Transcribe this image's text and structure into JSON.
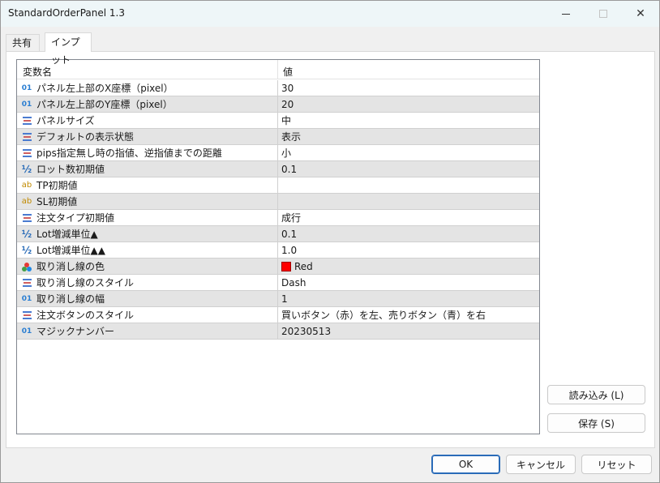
{
  "window": {
    "title": "StandardOrderPanel 1.3",
    "close_glyph": "✕"
  },
  "tabs": [
    {
      "label": "共有",
      "active": false
    },
    {
      "label": "インプット",
      "active": true
    }
  ],
  "grid": {
    "header": {
      "name": "変数名",
      "value": "値"
    },
    "rows": [
      {
        "icon": "int-icon",
        "name": "パネル左上部のX座標（pixel）",
        "value": "30"
      },
      {
        "icon": "int-icon",
        "name": "パネル左上部のY座標（pixel）",
        "value": "20"
      },
      {
        "icon": "enum-icon",
        "name": "パネルサイズ",
        "value": "中"
      },
      {
        "icon": "enum-icon",
        "name": "デフォルトの表示状態",
        "value": "表示"
      },
      {
        "icon": "enum-icon",
        "name": "pips指定無し時の指値、逆指値までの距離",
        "value": "小"
      },
      {
        "icon": "double-icon",
        "name": "ロット数初期値",
        "value": "0.1"
      },
      {
        "icon": "string-icon",
        "name": "TP初期値",
        "value": ""
      },
      {
        "icon": "string-icon",
        "name": "SL初期値",
        "value": ""
      },
      {
        "icon": "enum-icon",
        "name": "注文タイプ初期値",
        "value": "成行"
      },
      {
        "icon": "double-icon",
        "name": "Lot増減単位▲",
        "value": "0.1"
      },
      {
        "icon": "double-icon",
        "name": "Lot増減単位▲▲",
        "value": "1.0"
      },
      {
        "icon": "color-icon",
        "name": "取り消し線の色",
        "value": "Red",
        "swatch": "#ff0000"
      },
      {
        "icon": "enum-icon",
        "name": "取り消し線のスタイル",
        "value": "Dash"
      },
      {
        "icon": "int-icon",
        "name": "取り消し線の幅",
        "value": "1"
      },
      {
        "icon": "enum-icon",
        "name": "注文ボタンのスタイル",
        "value": "買いボタン（赤）を左、売りボタン（青）を右"
      },
      {
        "icon": "int-icon",
        "name": "マジックナンバー",
        "value": "20230513"
      }
    ]
  },
  "icon_glyphs": {
    "int": "01",
    "string": "ab",
    "double": "½"
  },
  "buttons": {
    "load": "読み込み (L)",
    "save": "保存 (S)",
    "ok": "OK",
    "cancel": "キャンセル",
    "reset": "リセット"
  }
}
